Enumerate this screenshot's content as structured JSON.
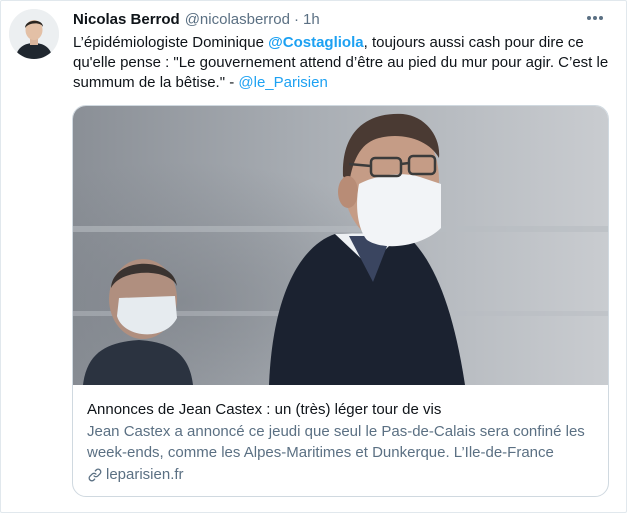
{
  "tweet": {
    "author_name": "Nicolas Berrod",
    "author_handle": "@nicolasberrod",
    "separator": "·",
    "time": "1h",
    "text_part1": "L’épidémiologiste Dominique ",
    "mention1": "@Costagliola",
    "text_part2": ", toujours aussi cash pour dire ce qu'elle pense : \"Le gouvernement attend d’être au pied du mur pour agir. C’est le summum de la bêtise.\" - ",
    "mention2": "@le_Parisien"
  },
  "card": {
    "title": "Annonces de Jean Castex : un (très) léger tour de vis",
    "description": "Jean Castex a annoncé ce jeudi que seul le Pas-de-Calais sera confiné les week-ends, comme les Alpes-Maritimes et Dunkerque. L’Ile-de-France",
    "domain": "leparisien.fr"
  },
  "icons": {
    "more": "more-horizontal-icon",
    "link": "link-icon"
  },
  "colors": {
    "link": "#1da1f2",
    "secondary_text": "#5b7083",
    "primary_text": "#0f1419",
    "card_border": "#d0d9e0"
  }
}
